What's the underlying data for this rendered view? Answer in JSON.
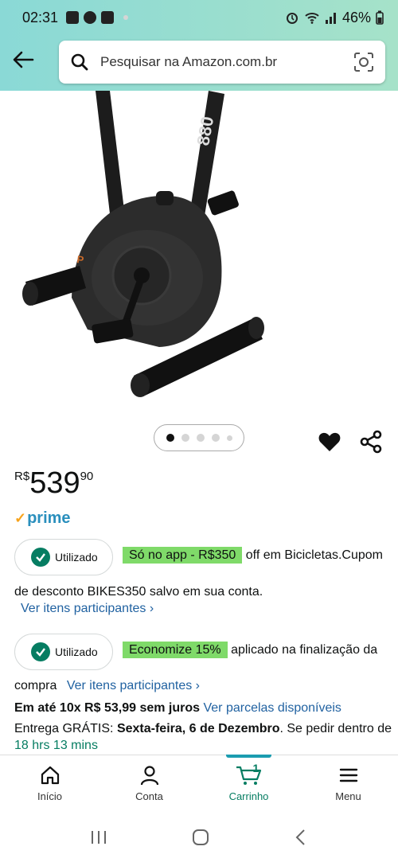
{
  "status": {
    "time": "02:31",
    "battery": "46%"
  },
  "search": {
    "placeholder": "Pesquisar na Amazon.com.br"
  },
  "product": {
    "price": {
      "currency": "R$",
      "whole": "539",
      "fraction": "90"
    },
    "prime": "prime"
  },
  "coupon1": {
    "badge": "Utilizado",
    "highlight": "Só no app - R$350",
    "text_a": " off em Bicicletas.Cupom",
    "text_b": "de desconto BIKES350 salvo em sua conta.",
    "link": "Ver itens participantes ›"
  },
  "coupon2": {
    "badge": "Utilizado",
    "highlight": "Economize 15%",
    "text_a": " aplicado na finalização da",
    "text_b": "compra",
    "link": "Ver itens participantes ›"
  },
  "installments": {
    "bold": "Em até 10x R$ 53,99 sem juros",
    "link": "Ver parcelas disponíveis"
  },
  "delivery": {
    "prefix": "Entrega GRÁTIS: ",
    "date": "Sexta-feira, 6 de Dezembro",
    "suffix": ". Se pedir dentro de",
    "countdown": "18 hrs 13 mins"
  },
  "tabs": [
    {
      "label": "Início"
    },
    {
      "label": "Conta"
    },
    {
      "label": "Carrinho",
      "count": "1"
    },
    {
      "label": "Menu"
    }
  ],
  "colors": {
    "accent_teal": "#1b9cb0",
    "green": "#067d62",
    "highlight": "#7fda69",
    "link": "#2162a1"
  }
}
